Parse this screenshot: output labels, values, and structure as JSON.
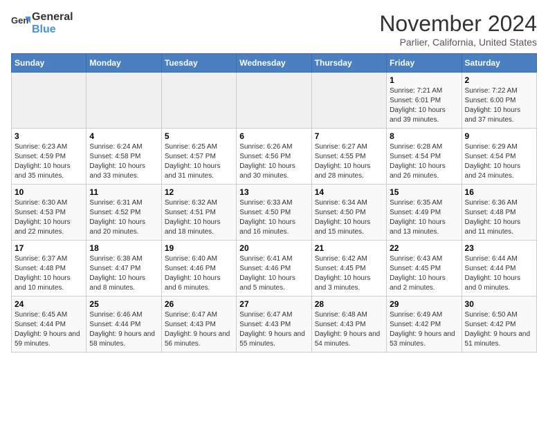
{
  "header": {
    "logo_line1": "General",
    "logo_line2": "Blue",
    "month": "November 2024",
    "location": "Parlier, California, United States"
  },
  "weekdays": [
    "Sunday",
    "Monday",
    "Tuesday",
    "Wednesday",
    "Thursday",
    "Friday",
    "Saturday"
  ],
  "weeks": [
    [
      {
        "day": "",
        "info": ""
      },
      {
        "day": "",
        "info": ""
      },
      {
        "day": "",
        "info": ""
      },
      {
        "day": "",
        "info": ""
      },
      {
        "day": "",
        "info": ""
      },
      {
        "day": "1",
        "info": "Sunrise: 7:21 AM\nSunset: 6:01 PM\nDaylight: 10 hours and 39 minutes."
      },
      {
        "day": "2",
        "info": "Sunrise: 7:22 AM\nSunset: 6:00 PM\nDaylight: 10 hours and 37 minutes."
      }
    ],
    [
      {
        "day": "3",
        "info": "Sunrise: 6:23 AM\nSunset: 4:59 PM\nDaylight: 10 hours and 35 minutes."
      },
      {
        "day": "4",
        "info": "Sunrise: 6:24 AM\nSunset: 4:58 PM\nDaylight: 10 hours and 33 minutes."
      },
      {
        "day": "5",
        "info": "Sunrise: 6:25 AM\nSunset: 4:57 PM\nDaylight: 10 hours and 31 minutes."
      },
      {
        "day": "6",
        "info": "Sunrise: 6:26 AM\nSunset: 4:56 PM\nDaylight: 10 hours and 30 minutes."
      },
      {
        "day": "7",
        "info": "Sunrise: 6:27 AM\nSunset: 4:55 PM\nDaylight: 10 hours and 28 minutes."
      },
      {
        "day": "8",
        "info": "Sunrise: 6:28 AM\nSunset: 4:54 PM\nDaylight: 10 hours and 26 minutes."
      },
      {
        "day": "9",
        "info": "Sunrise: 6:29 AM\nSunset: 4:54 PM\nDaylight: 10 hours and 24 minutes."
      }
    ],
    [
      {
        "day": "10",
        "info": "Sunrise: 6:30 AM\nSunset: 4:53 PM\nDaylight: 10 hours and 22 minutes."
      },
      {
        "day": "11",
        "info": "Sunrise: 6:31 AM\nSunset: 4:52 PM\nDaylight: 10 hours and 20 minutes."
      },
      {
        "day": "12",
        "info": "Sunrise: 6:32 AM\nSunset: 4:51 PM\nDaylight: 10 hours and 18 minutes."
      },
      {
        "day": "13",
        "info": "Sunrise: 6:33 AM\nSunset: 4:50 PM\nDaylight: 10 hours and 16 minutes."
      },
      {
        "day": "14",
        "info": "Sunrise: 6:34 AM\nSunset: 4:50 PM\nDaylight: 10 hours and 15 minutes."
      },
      {
        "day": "15",
        "info": "Sunrise: 6:35 AM\nSunset: 4:49 PM\nDaylight: 10 hours and 13 minutes."
      },
      {
        "day": "16",
        "info": "Sunrise: 6:36 AM\nSunset: 4:48 PM\nDaylight: 10 hours and 11 minutes."
      }
    ],
    [
      {
        "day": "17",
        "info": "Sunrise: 6:37 AM\nSunset: 4:48 PM\nDaylight: 10 hours and 10 minutes."
      },
      {
        "day": "18",
        "info": "Sunrise: 6:38 AM\nSunset: 4:47 PM\nDaylight: 10 hours and 8 minutes."
      },
      {
        "day": "19",
        "info": "Sunrise: 6:40 AM\nSunset: 4:46 PM\nDaylight: 10 hours and 6 minutes."
      },
      {
        "day": "20",
        "info": "Sunrise: 6:41 AM\nSunset: 4:46 PM\nDaylight: 10 hours and 5 minutes."
      },
      {
        "day": "21",
        "info": "Sunrise: 6:42 AM\nSunset: 4:45 PM\nDaylight: 10 hours and 3 minutes."
      },
      {
        "day": "22",
        "info": "Sunrise: 6:43 AM\nSunset: 4:45 PM\nDaylight: 10 hours and 2 minutes."
      },
      {
        "day": "23",
        "info": "Sunrise: 6:44 AM\nSunset: 4:44 PM\nDaylight: 10 hours and 0 minutes."
      }
    ],
    [
      {
        "day": "24",
        "info": "Sunrise: 6:45 AM\nSunset: 4:44 PM\nDaylight: 9 hours and 59 minutes."
      },
      {
        "day": "25",
        "info": "Sunrise: 6:46 AM\nSunset: 4:44 PM\nDaylight: 9 hours and 58 minutes."
      },
      {
        "day": "26",
        "info": "Sunrise: 6:47 AM\nSunset: 4:43 PM\nDaylight: 9 hours and 56 minutes."
      },
      {
        "day": "27",
        "info": "Sunrise: 6:47 AM\nSunset: 4:43 PM\nDaylight: 9 hours and 55 minutes."
      },
      {
        "day": "28",
        "info": "Sunrise: 6:48 AM\nSunset: 4:43 PM\nDaylight: 9 hours and 54 minutes."
      },
      {
        "day": "29",
        "info": "Sunrise: 6:49 AM\nSunset: 4:42 PM\nDaylight: 9 hours and 53 minutes."
      },
      {
        "day": "30",
        "info": "Sunrise: 6:50 AM\nSunset: 4:42 PM\nDaylight: 9 hours and 51 minutes."
      }
    ]
  ]
}
